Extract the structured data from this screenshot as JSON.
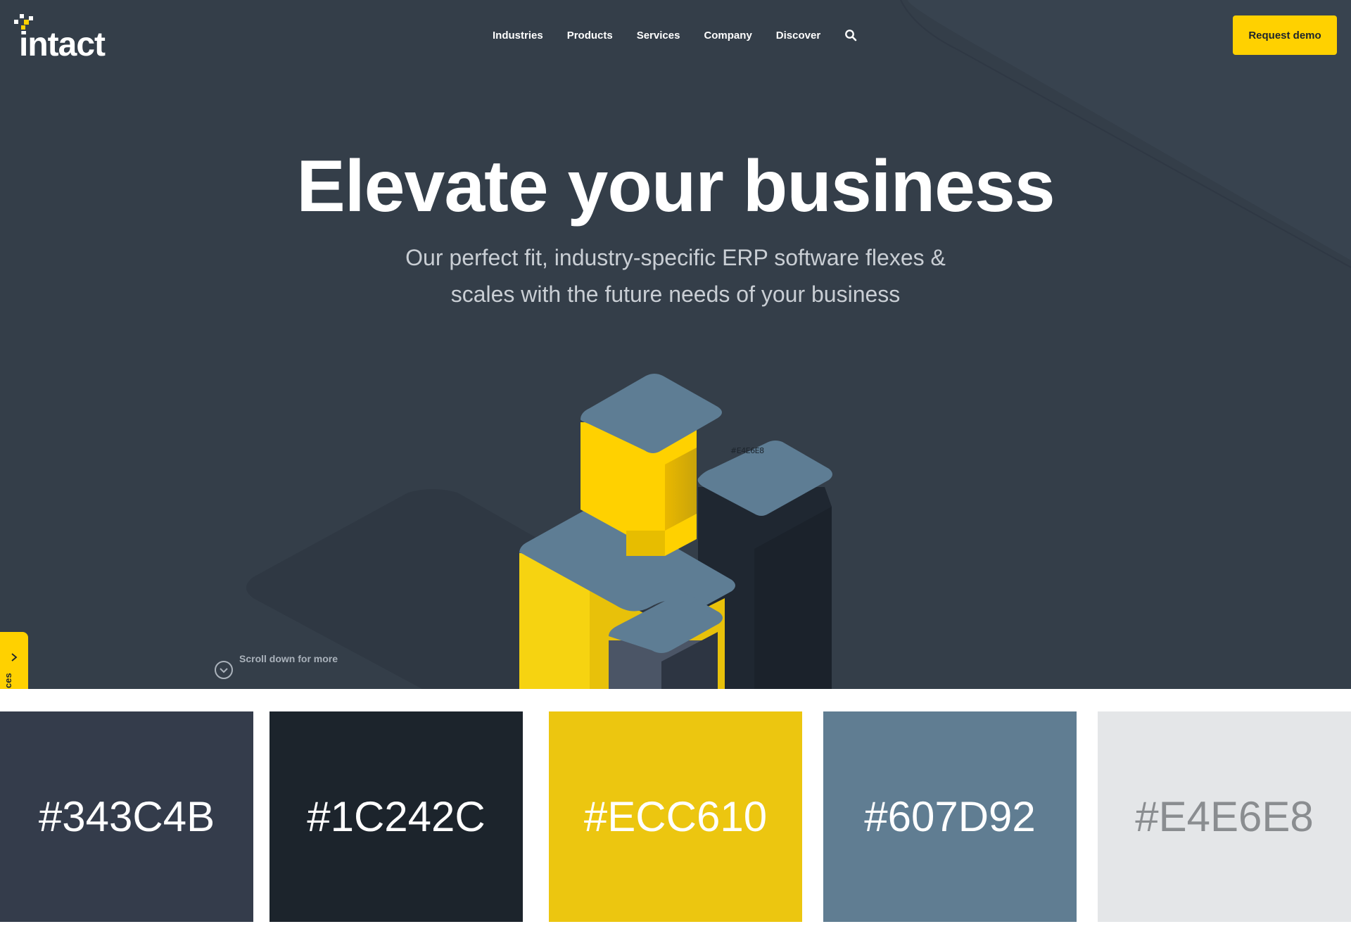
{
  "brand": {
    "logo_text": "intact",
    "accent": "#ffd100"
  },
  "nav": {
    "items": [
      "Industries",
      "Products",
      "Services",
      "Company",
      "Discover"
    ],
    "search_icon": "search-icon"
  },
  "header": {
    "cta_label": "Request demo"
  },
  "hero": {
    "title": "Elevate your business",
    "subtitle_line1": "Our perfect fit, industry-specific ERP software flexes &",
    "subtitle_line2": "scales with the future needs of your business",
    "illustration_tag": "#E4E6E8",
    "background": "#343e49"
  },
  "side_tab": {
    "label": "ces",
    "icon": "chevron-right-icon"
  },
  "scroll_hint": {
    "label": "Scroll down for more",
    "icon": "chevron-down-circle-icon"
  },
  "palette": [
    {
      "label": "#343C4B",
      "bg": "#343c4b",
      "fg": "#ffffff"
    },
    {
      "label": "#1C242C",
      "bg": "#1c242c",
      "fg": "#ffffff"
    },
    {
      "label": "#ECC610",
      "bg": "#ecc610",
      "fg": "#ffffff"
    },
    {
      "label": "#607D92",
      "bg": "#607d92",
      "fg": "#ffffff"
    },
    {
      "label": "#E4E6E8",
      "bg": "#e4e6e8",
      "fg": "#8a8d90"
    }
  ]
}
